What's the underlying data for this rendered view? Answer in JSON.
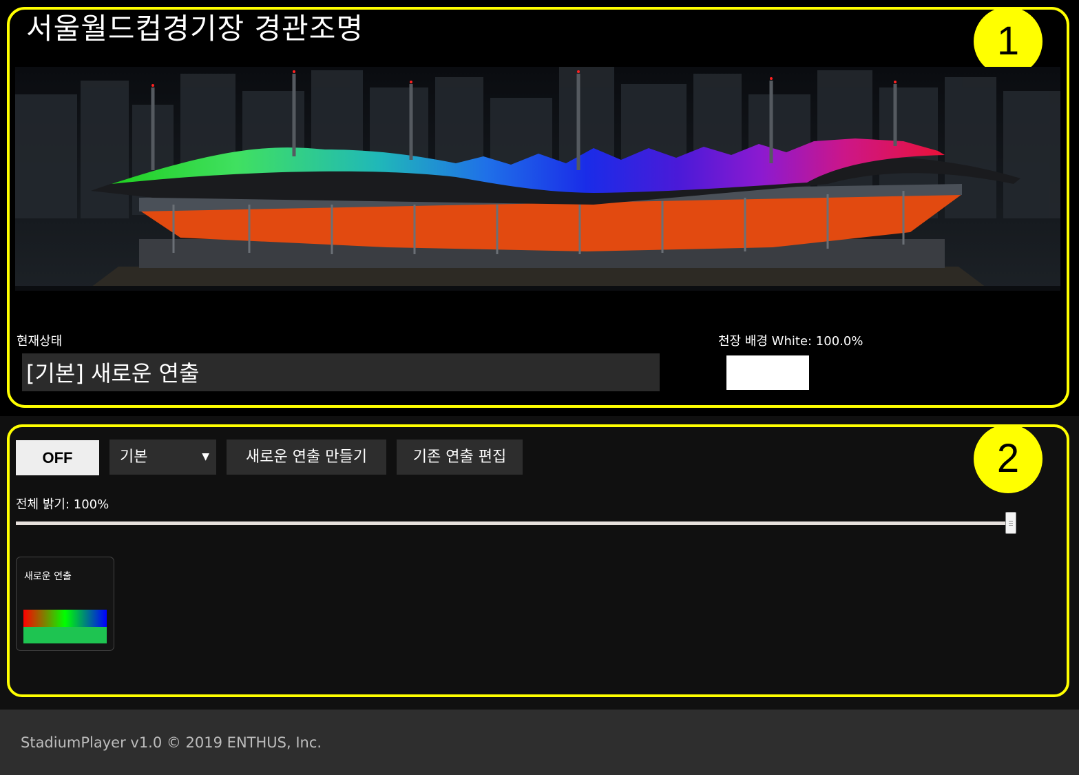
{
  "header": {
    "title": "서울월드컵경기장 경관조명",
    "badge": "1"
  },
  "stadium": {
    "roof_colors": [
      "#1fcf1f",
      "#3fe05c",
      "#1fbfbf",
      "#1f6fe6",
      "#1a2be8",
      "#4b1ad8",
      "#8a1ad0",
      "#c8168a",
      "#e8133d"
    ],
    "stand_color": "#e24a10"
  },
  "status": {
    "label": "현재상태",
    "value": "[기본] 새로운 연출"
  },
  "ceiling": {
    "label": "천장 배경 White: 100.0%",
    "color": "#ffffff",
    "level": 100.0
  },
  "controls": {
    "badge": "2",
    "off_label": "OFF",
    "mode_selected": "기본",
    "new_show_label": "새로운 연출 만들기",
    "edit_show_label": "기존 연출 편집",
    "brightness_label": "전체 밝기: 100%",
    "brightness_value": 100
  },
  "shows": [
    {
      "title": "새로운 연출",
      "preview_colors": [
        "#ff0000",
        "#00ff00",
        "#0000ff"
      ],
      "preview_bottom": "#1ec451"
    }
  ],
  "footer": {
    "text": "StadiumPlayer v1.0 © 2019 ENTHUS, Inc."
  }
}
